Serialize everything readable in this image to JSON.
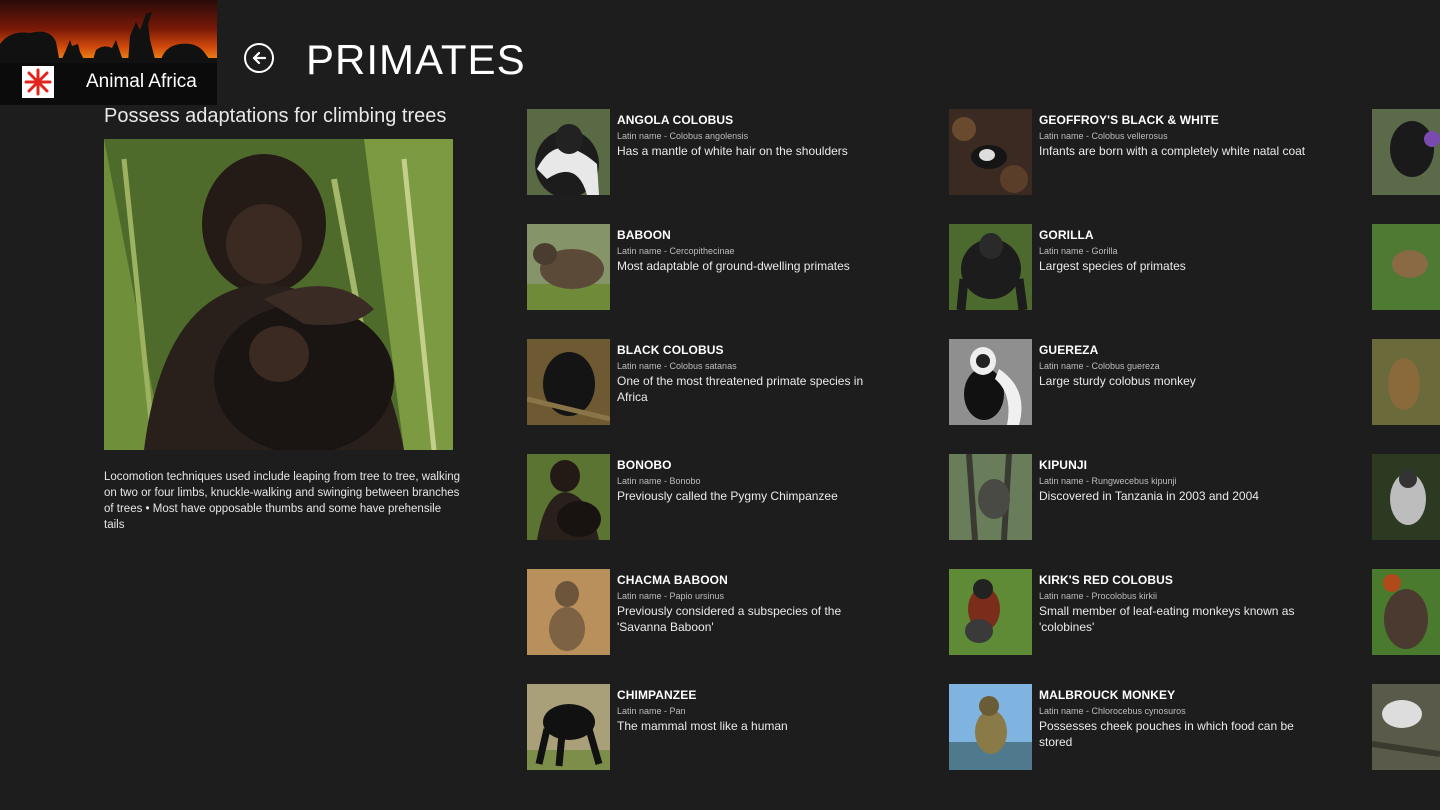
{
  "app": {
    "name": "Animal Africa"
  },
  "header": {
    "title": "PRIMATES",
    "back_icon": "back-arrow-icon"
  },
  "feature": {
    "heading": "Possess adaptations for climbing trees",
    "description": "Locomotion techniques used include leaping from tree to tree, walking on two or four limbs, knuckle-walking and swinging between branches of trees • Most have opposable thumbs and some have prehensile tails"
  },
  "column1": [
    {
      "name": "ANGOLA COLOBUS",
      "latin": "Latin name - Colobus angolensis",
      "description": "Has a mantle of white hair on the shoulders"
    },
    {
      "name": "BABOON",
      "latin": "Latin name - Cercopithecinae",
      "description": "Most adaptable of ground-dwelling primates"
    },
    {
      "name": "BLACK COLOBUS",
      "latin": "Latin name - Colobus satanas",
      "description": "One of the most threatened primate species in Africa"
    },
    {
      "name": "BONOBO",
      "latin": "Latin name - Bonobo",
      "description": "Previously called the Pygmy Chimpanzee"
    },
    {
      "name": "CHACMA BABOON",
      "latin": "Latin name - Papio ursinus",
      "description": "Previously considered a subspecies of the 'Savanna Baboon'"
    },
    {
      "name": "CHIMPANZEE",
      "latin": "Latin name - Pan",
      "description": "The mammal most like a human"
    }
  ],
  "column2": [
    {
      "name": "GEOFFROY'S BLACK & WHITE",
      "latin": "Latin name - Colobus vellerosus",
      "description": "Infants are born with a completely white natal coat"
    },
    {
      "name": "GORILLA",
      "latin": "Latin name - Gorilla",
      "description": "Largest species of primates"
    },
    {
      "name": "GUEREZA",
      "latin": "Latin name - Colobus guereza",
      "description": "Large sturdy colobus monkey"
    },
    {
      "name": "KIPUNJI",
      "latin": "Latin name - Rungwecebus kipunji",
      "description": "Discovered in Tanzania in 2003 and 2004"
    },
    {
      "name": "KIRK'S RED COLOBUS",
      "latin": "Latin name - Procolobus kirkii",
      "description": "Small member of leaf-eating monkeys known as 'colobines'"
    },
    {
      "name": "MALBROUCK MONKEY",
      "latin": "Latin name - Chlorocebus cynosuros",
      "description": "Possesses cheek pouches in which food can be stored"
    }
  ],
  "colors": {
    "background": "#1d1d1d",
    "text": "#ffffff",
    "subtext": "#bdbdbd"
  }
}
